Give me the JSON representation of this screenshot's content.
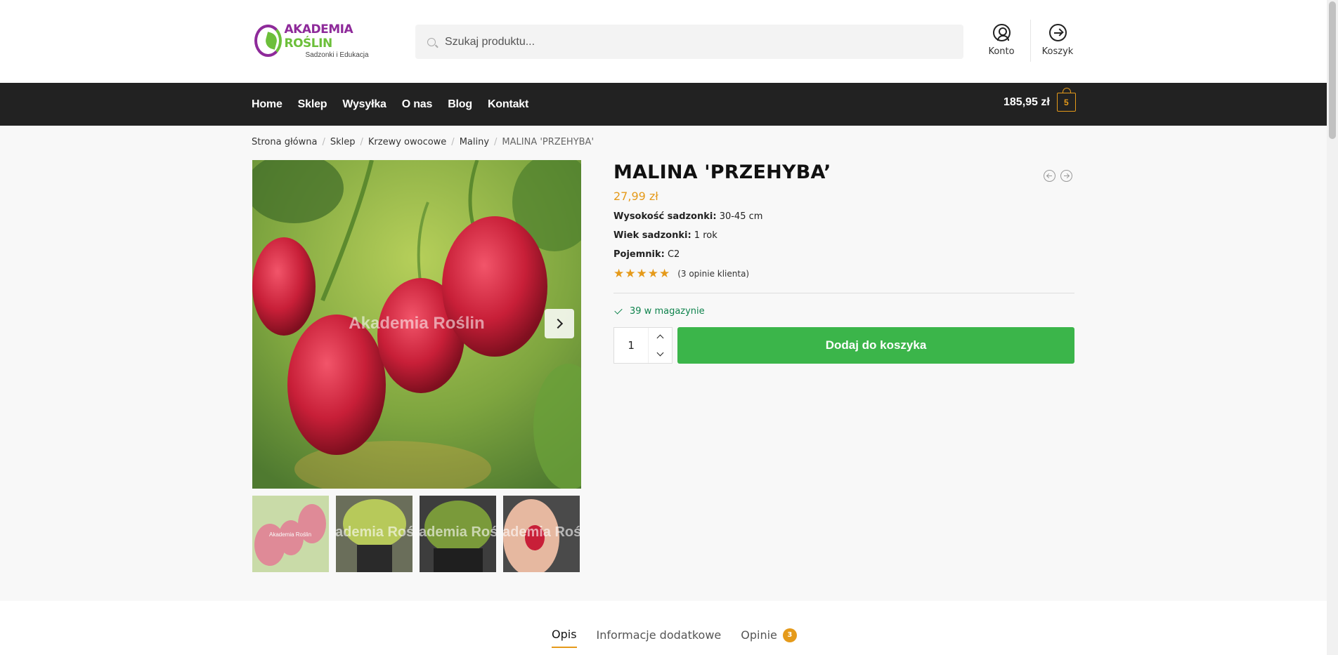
{
  "logo": {
    "title_part1": "AKADEMIA ",
    "title_part2": "ROŚLIN",
    "subtitle": "Sadzonki i Edukacja"
  },
  "search": {
    "placeholder": "Szukaj produktu..."
  },
  "header": {
    "account_label": "Konto",
    "cart_label": "Koszyk"
  },
  "nav": {
    "items": [
      "Home",
      "Sklep",
      "Wysyłka",
      "O nas",
      "Blog",
      "Kontakt"
    ],
    "cart_total": "185,95 zł",
    "cart_count": "5"
  },
  "breadcrumb": {
    "items": [
      "Strona główna",
      "Sklep",
      "Krzewy owocowe",
      "Maliny"
    ],
    "current": "MALINA 'PRZEHYBA'"
  },
  "gallery": {
    "watermark": "Akademia Roślin",
    "thumb_watermarks": [
      "Akademia Roślin",
      "Akademia Roślin",
      "Akademia Roślin",
      "Akademia Roślin"
    ]
  },
  "product": {
    "title": "MALINA 'PRZEHYBA’",
    "price": "27,99 zł",
    "attributes": [
      {
        "label": "Wysokość sadzonki:",
        "value": " 30-45 cm"
      },
      {
        "label": "Wiek sadzonki:",
        "value": " 1 rok"
      },
      {
        "label": "Pojemnik:",
        "value": " C2"
      }
    ],
    "rating": 5,
    "stars": "★★★★★",
    "reviews_text": "(3 opinie klienta)",
    "stock_text": "39 w magazynie",
    "quantity": "1",
    "add_to_cart": "Dodaj do koszyka"
  },
  "tabs": {
    "items": [
      "Opis",
      "Informacje dodatkowe",
      "Opinie"
    ],
    "reviews_badge": "3"
  },
  "colors": {
    "accent": "#e59a1a",
    "primary_button": "#3bb54a",
    "navbar": "#222222",
    "stock": "#0f834d",
    "logo_purple": "#8e2a9a",
    "logo_green": "#6cbf3a"
  }
}
